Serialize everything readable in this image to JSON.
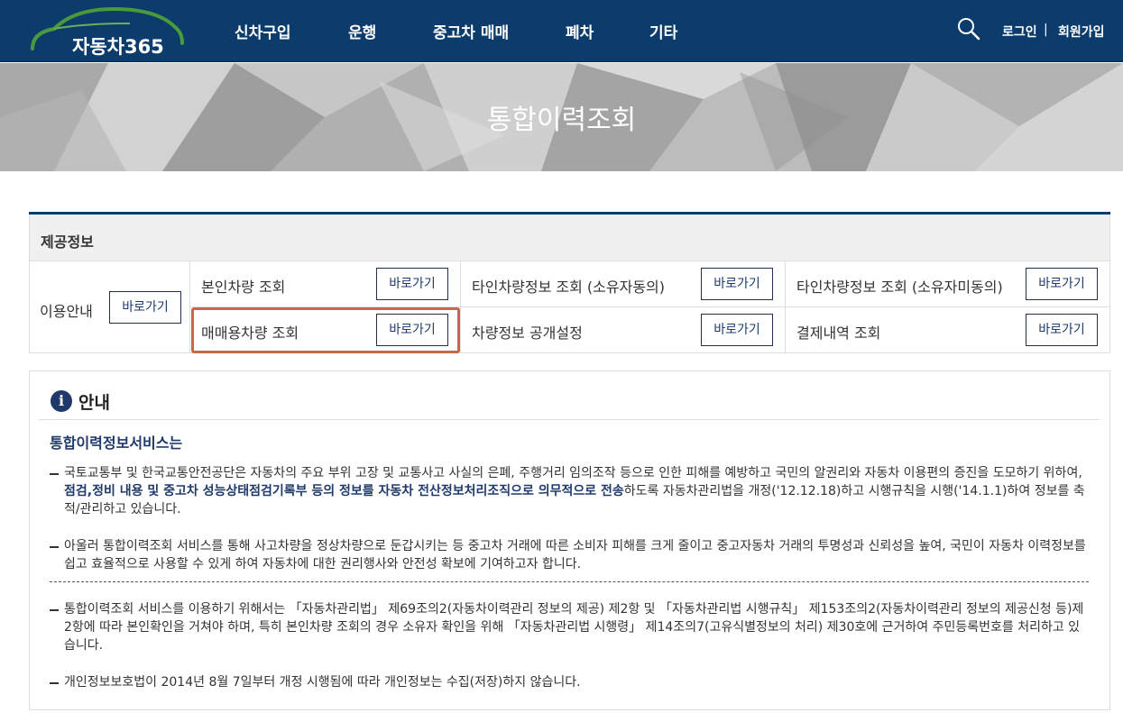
{
  "header": {
    "logo_text": "자동차365",
    "nav": [
      "신차구입",
      "운행",
      "중고차 매매",
      "폐차",
      "기타"
    ],
    "login": "로그인",
    "separator": "|",
    "signup": "회원가입",
    "search_icon": "search-icon"
  },
  "banner": {
    "title": "통합이력조회"
  },
  "info": {
    "heading": "제공정보",
    "usage": {
      "label": "이용안내",
      "button": "바로가기"
    },
    "items": [
      {
        "label": "본인차량 조회",
        "button": "바로가기"
      },
      {
        "label": "타인차량정보 조회 (소유자동의)",
        "button": "바로가기"
      },
      {
        "label": "타인차량정보 조회 (소유자미동의)",
        "button": "바로가기"
      },
      {
        "label": "매매용차량 조회",
        "button": "바로가기"
      },
      {
        "label": "차량정보 공개설정",
        "button": "바로가기"
      },
      {
        "label": "결제내역 조회",
        "button": "바로가기"
      }
    ]
  },
  "notice": {
    "icon": "i",
    "title": "안내",
    "subtitle": "통합이력정보서비스는",
    "p1_a": "국토교통부 및 한국교통안전공단은 자동차의 주요 부위 고장 및 교통사고 사실의 은폐, 주행거리 임의조작 등으로 인한 피해를 예방하고 국민의 알권리와 자동차 이용편의 증진을 도모하기 위하여, ",
    "p1_b": "점검,정비 내용 및 중고차 성능상태점검기록부 등의 정보를 자동차 전산정보처리조직으로 의무적으로 전송",
    "p1_c": "하도록 자동차관리법을 개정('12.12.18)하고 시행규칙을 시행('14.1.1)하여 정보를 축적/관리하고 있습니다.",
    "p2": "아울러 통합이력조회 서비스를 통해 사고차량을 정상차량으로 둔갑시키는 등 중고차 거래에 따른 소비자 피해를 크게 줄이고 중고자동차 거래의 투명성과 신뢰성을 높여, 국민이 자동차 이력정보를 쉽고 효율적으로 사용할 수 있게 하여 자동차에 대한 권리행사와 안전성 확보에 기여하고자 합니다.",
    "p3": "통합이력조회 서비스를 이용하기 위해서는 「자동차관리법」 제69조의2(자동차이력관리 정보의 제공) 제2항 및 「자동차관리법 시행규칙」 제153조의2(자동차이력관리 정보의 제공신청 등)제2항에 따라 본인확인을 거쳐야 하며, 특히 본인차량 조회의 경우 소유자 확인을 위해 「자동차관리법 시행령」 제14조의7(고유식별정보의 처리) 제30호에 근거하여 주민등록번호를 처리하고 있습니다.",
    "p4": "개인정보보호법이 2014년 8월 7일부터 개정 시행됨에 따라 개인정보는 수집(저장)하지 않습니다."
  }
}
